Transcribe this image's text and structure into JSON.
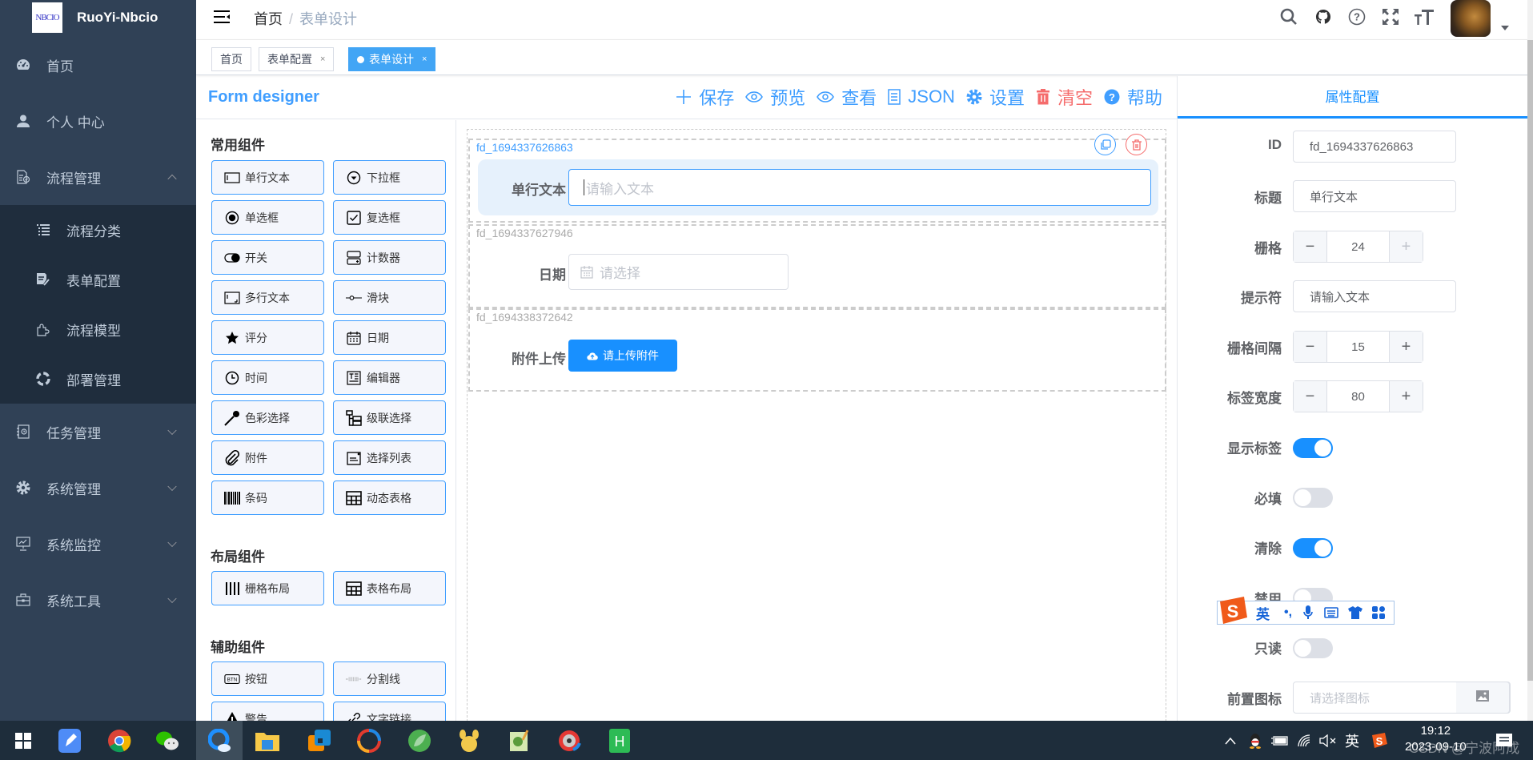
{
  "app": {
    "name": "RuoYi-Nbcio",
    "logo_text": "NBCIO"
  },
  "sidebar": {
    "items": [
      {
        "label": "首页",
        "icon": "dashboard-icon"
      },
      {
        "label": "个人 中心",
        "icon": "user-icon"
      },
      {
        "label": "流程管理",
        "icon": "process-icon",
        "expanded": true,
        "children": [
          {
            "label": "流程分类",
            "icon": "list-icon"
          },
          {
            "label": "表单配置",
            "icon": "form-edit-icon"
          },
          {
            "label": "流程模型",
            "icon": "plugin-icon"
          },
          {
            "label": "部署管理",
            "icon": "lifebuoy-icon"
          }
        ]
      },
      {
        "label": "任务管理",
        "icon": "task-icon",
        "expanded": false
      },
      {
        "label": "系统管理",
        "icon": "gear-icon",
        "expanded": false
      },
      {
        "label": "系统监控",
        "icon": "monitor-icon",
        "expanded": false
      },
      {
        "label": "系统工具",
        "icon": "toolbox-icon",
        "expanded": false
      }
    ]
  },
  "navbar": {
    "breadcrumb": [
      "首页",
      "表单设计"
    ],
    "icons": [
      "search-icon",
      "github-icon",
      "question-icon",
      "fullscreen-icon",
      "font-size-icon"
    ]
  },
  "tags": [
    {
      "label": "首页",
      "closable": false,
      "active": false
    },
    {
      "label": "表单配置",
      "closable": true,
      "active": false
    },
    {
      "label": "表单设计",
      "closable": true,
      "active": true
    }
  ],
  "designer": {
    "title": "Form designer",
    "toolbar": [
      {
        "label": "保存",
        "icon": "plus-icon"
      },
      {
        "label": "预览",
        "icon": "eye-icon"
      },
      {
        "label": "查看",
        "icon": "eye-icon"
      },
      {
        "label": "JSON",
        "icon": "document-icon"
      },
      {
        "label": "设置",
        "icon": "gear-icon"
      },
      {
        "label": "清空",
        "icon": "trash-icon",
        "danger": true
      },
      {
        "label": "帮助",
        "icon": "help-icon"
      }
    ],
    "groups": [
      {
        "title": "常用组件",
        "items": [
          {
            "label": "单行文本",
            "icon": "input-icon"
          },
          {
            "label": "下拉框",
            "icon": "select-icon"
          },
          {
            "label": "单选框",
            "icon": "radio-icon"
          },
          {
            "label": "复选框",
            "icon": "checkbox-icon"
          },
          {
            "label": "开关",
            "icon": "switch-icon"
          },
          {
            "label": "计数器",
            "icon": "number-icon"
          },
          {
            "label": "多行文本",
            "icon": "textarea-icon"
          },
          {
            "label": "滑块",
            "icon": "slider-icon"
          },
          {
            "label": "评分",
            "icon": "star-icon"
          },
          {
            "label": "日期",
            "icon": "calendar-icon"
          },
          {
            "label": "时间",
            "icon": "clock-icon"
          },
          {
            "label": "编辑器",
            "icon": "editor-icon"
          },
          {
            "label": "色彩选择",
            "icon": "color-picker-icon"
          },
          {
            "label": "级联选择",
            "icon": "cascader-icon"
          },
          {
            "label": "附件",
            "icon": "paperclip-icon"
          },
          {
            "label": "选择列表",
            "icon": "select-list-icon"
          },
          {
            "label": "条码",
            "icon": "barcode-icon"
          },
          {
            "label": "动态表格",
            "icon": "table-icon"
          }
        ]
      },
      {
        "title": "布局组件",
        "items": [
          {
            "label": "栅格布局",
            "icon": "grid-icon"
          },
          {
            "label": "表格布局",
            "icon": "table-icon"
          }
        ]
      },
      {
        "title": "辅助组件",
        "items": [
          {
            "label": "按钮",
            "icon": "button-icon"
          },
          {
            "label": "分割线",
            "icon": "divider-icon"
          },
          {
            "label": "警告",
            "icon": "warning-icon"
          },
          {
            "label": "文字链接",
            "icon": "link-icon"
          }
        ]
      }
    ],
    "canvas": {
      "fields": [
        {
          "id": "fd_1694337626863",
          "label": "单行文本",
          "placeholder": "请输入文本",
          "selected": true
        },
        {
          "id": "fd_1694337627946",
          "label": "日期",
          "placeholder": "请选择"
        },
        {
          "id": "fd_1694338372642",
          "label": "附件上传",
          "button": "请上传附件"
        }
      ]
    }
  },
  "properties": {
    "tab": "属性配置",
    "id_label": "ID",
    "id_value": "fd_1694337626863",
    "title_label": "标题",
    "title_value": "单行文本",
    "span_label": "栅格",
    "span_value": "24",
    "placeholder_label": "提示符",
    "placeholder_value": "请输入文本",
    "gutter_label": "栅格间隔",
    "gutter_value": "15",
    "label_width_label": "标签宽度",
    "label_width_value": "80",
    "show_label": {
      "label": "显示标签",
      "on": true
    },
    "required": {
      "label": "必填",
      "on": false
    },
    "clearable": {
      "label": "清除",
      "on": true
    },
    "disabled": {
      "label": "禁用",
      "on": false
    },
    "readonly": {
      "label": "只读",
      "on": false
    },
    "prefix_icon_label": "前置图标",
    "prefix_icon_placeholder": "请选择图标"
  },
  "ime_toolbar": {
    "mode": "英",
    "items": [
      "punctuation",
      "mic",
      "keyboard",
      "skin",
      "apps"
    ]
  },
  "taskbar": {
    "apps": [
      "windows-start",
      "notes",
      "chrome",
      "wechat",
      "browser-q",
      "file-explorer",
      "vmware",
      "qq-browser",
      "spring",
      "yellow-app",
      "notepad-plus",
      "media-app",
      "hbuilder"
    ],
    "tray": {
      "ime": "英",
      "time": "19:12",
      "date": "2023-09-10"
    },
    "watermark": "CSDN @宁波阿成"
  }
}
